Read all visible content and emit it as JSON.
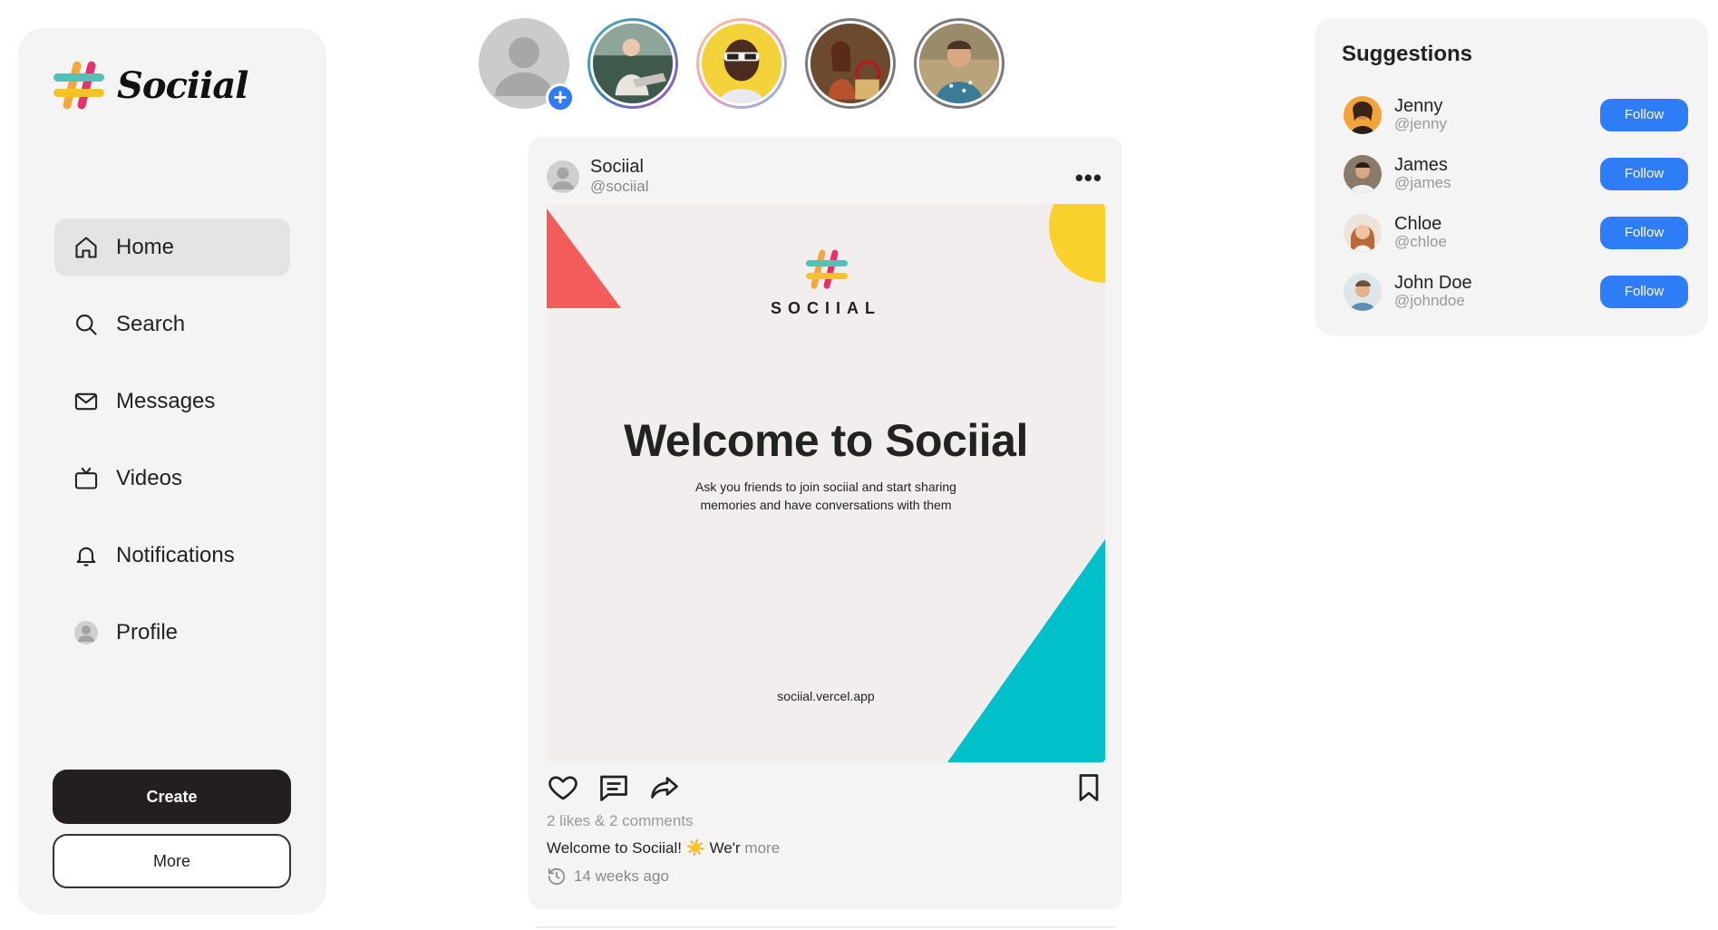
{
  "app": {
    "name": "Sociial"
  },
  "sidebar": {
    "items": [
      {
        "label": "Home",
        "icon": "home-icon",
        "active": true
      },
      {
        "label": "Search",
        "icon": "search-icon"
      },
      {
        "label": "Messages",
        "icon": "mail-icon"
      },
      {
        "label": "Videos",
        "icon": "tv-icon"
      },
      {
        "label": "Notifications",
        "icon": "bell-icon"
      },
      {
        "label": "Profile",
        "icon": "profile-avatar-icon"
      }
    ],
    "create_label": "Create",
    "more_label": "More"
  },
  "stories": [
    {
      "type": "own",
      "icon": "plus-icon"
    },
    {
      "type": "user",
      "ring": "#4fb7a9"
    },
    {
      "type": "user",
      "ring": "#f7c8a0"
    },
    {
      "type": "user",
      "ring": "#8a8a8a"
    },
    {
      "type": "user",
      "ring": "#8a8a8a"
    }
  ],
  "post": {
    "author": "Sociial",
    "handle": "@sociial",
    "image": {
      "brand": "SOCIIAL",
      "title": "Welcome to Sociial",
      "subtitle_line1": "Ask you friends to join sociial and start sharing",
      "subtitle_line2": "memories and have  conversations with them",
      "url": "sociial.vercel.app"
    },
    "stats": "2 likes & 2 comments",
    "caption": "Welcome to Sociial! ☀️ We'r",
    "caption_more": "more",
    "time": "14 weeks ago"
  },
  "suggestions": {
    "title": "Suggestions",
    "users": [
      {
        "name": "Jenny",
        "handle": "@jenny",
        "button": "Follow"
      },
      {
        "name": "James",
        "handle": "@james",
        "button": "Follow"
      },
      {
        "name": "Chloe",
        "handle": "@chloe",
        "button": "Follow"
      },
      {
        "name": "John Doe",
        "handle": "@johndoe",
        "button": "Follow"
      }
    ]
  },
  "colors": {
    "accent": "#2e7df6",
    "brand_red": "#f45b5b",
    "brand_teal": "#00c1c9",
    "brand_yellow": "#fbd22c"
  }
}
